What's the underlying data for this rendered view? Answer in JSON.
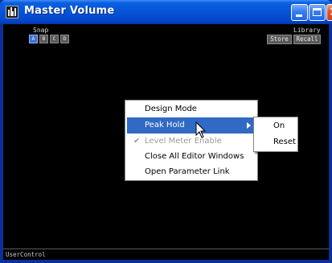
{
  "window": {
    "title": "Master Volume"
  },
  "snap": {
    "label": "Snap",
    "buttons": [
      "A",
      "B",
      "C",
      "D"
    ],
    "active": "A"
  },
  "library": {
    "label": "Library",
    "store": "Store",
    "recall": "Recall"
  },
  "status": {
    "text": "UserControl"
  },
  "context_menu": {
    "items": [
      {
        "label": "Design Mode"
      },
      {
        "label": "Peak Hold",
        "highlighted": true,
        "has_submenu": true
      },
      {
        "label": "Level Meter Enable",
        "disabled": true,
        "checked": true
      },
      {
        "label": "Close All Editor Windows"
      },
      {
        "label": "Open Parameter Link"
      }
    ]
  },
  "submenu": {
    "items": [
      {
        "label": "On"
      },
      {
        "label": "Reset"
      }
    ]
  },
  "colors": {
    "highlight": "#316ac5",
    "titlebar": "#0553d8",
    "client_bg": "#000000"
  }
}
